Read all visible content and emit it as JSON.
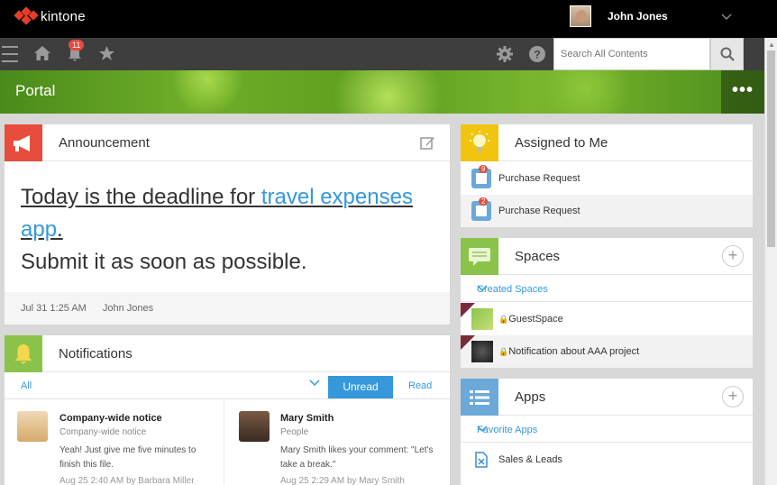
{
  "app": {
    "name": "kintone"
  },
  "user": {
    "name": "John Jones"
  },
  "nav": {
    "notification_count": "11",
    "search_placeholder": "Search All Contents"
  },
  "portal": {
    "title": "Portal",
    "more": "•••"
  },
  "announcement": {
    "title": "Announcement",
    "line1_prefix": "Today is the deadline for ",
    "link_text": "travel expenses app",
    "line1_suffix": ".",
    "line2": "Submit it as soon as possible.",
    "date": "Jul 31 1:25 AM",
    "author": "John Jones"
  },
  "notifications": {
    "title": "Notifications",
    "filter": "All",
    "unread_label": "Unread",
    "read_label": "Read",
    "items": [
      {
        "title": "Company-wide notice",
        "subtitle": "Company-wide notice",
        "body": "Yeah! Just give me five minutes to finish this file.",
        "meta": "Aug 25 2:40 AM  by Barbara Miller"
      },
      {
        "title": "Mary Smith",
        "subtitle": "People",
        "body": "Mary Smith likes your comment: \"Let's take a break.\"",
        "meta": "Aug 25 2:29 AM  by Mary Smith"
      }
    ]
  },
  "assigned": {
    "title": "Assigned to Me",
    "items": [
      {
        "label": "Purchase Request",
        "count": "9"
      },
      {
        "label": "Purchase Request",
        "count": "2"
      }
    ]
  },
  "spaces": {
    "title": "Spaces",
    "section": "Created Spaces",
    "items": [
      {
        "label": "GuestSpace"
      },
      {
        "label": "Notification about AAA project"
      }
    ]
  },
  "apps": {
    "title": "Apps",
    "section": "Favorite Apps",
    "items": [
      {
        "label": "Sales & Leads"
      }
    ]
  },
  "colors": {
    "topbar": "#000000",
    "navbar": "#3e3e3e",
    "accent_blue": "#3498db",
    "announcement_icon": "#e74c3c",
    "notifications_icon": "#8bc34a",
    "assigned_icon": "#f1c40f",
    "spaces_icon": "#8bc34a",
    "apps_icon": "#6aa9d9"
  }
}
